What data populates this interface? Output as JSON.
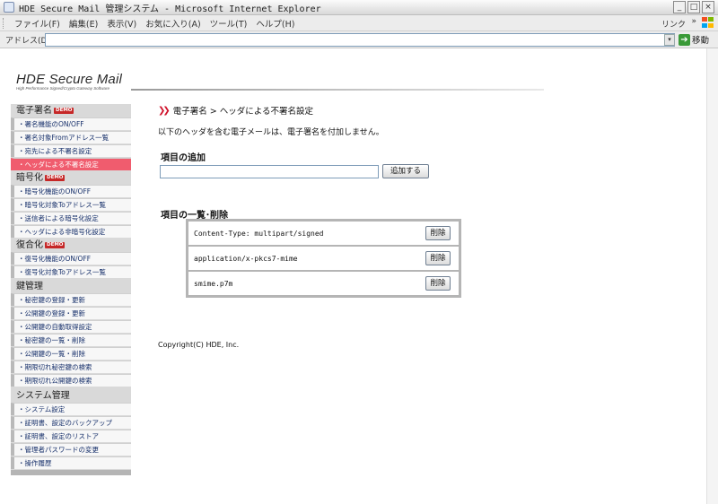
{
  "window": {
    "title": "HDE Secure Mail 管理システム - Microsoft Internet Explorer",
    "controls": [
      "_",
      "□",
      "×"
    ]
  },
  "menu": {
    "items": [
      "ファイル(F)",
      "編集(E)",
      "表示(V)",
      "お気に入り(A)",
      "ツール(T)",
      "ヘルプ(H)"
    ],
    "links_label": "リンク",
    "chevron": "»"
  },
  "address": {
    "label": "アドレス(D)",
    "value": "",
    "go_label": "移動",
    "drop_glyph": "▾",
    "go_glyph": "➔"
  },
  "logo": {
    "title": "HDE Secure Mail",
    "tagline": "High Performance Signed/Crypto Gateway Software"
  },
  "sidebar": {
    "badge": "DEMO",
    "sections": [
      {
        "label": "電子署名",
        "badge": true,
        "items": [
          "・署名機能のON/OFF",
          "・署名対象Fromアドレス一覧",
          "・宛先による不署名設定",
          "・ヘッダによる不署名設定"
        ]
      },
      {
        "label": "暗号化",
        "badge": true,
        "items": [
          "・暗号化機能のON/OFF",
          "・暗号化対象Toアドレス一覧",
          "・送信者による暗号化設定",
          "・ヘッダによる非暗号化設定"
        ]
      },
      {
        "label": "復合化",
        "badge": true,
        "items": [
          "・復号化機能のON/OFF",
          "・復号化対象Toアドレス一覧"
        ]
      },
      {
        "label": "鍵管理",
        "badge": false,
        "items": [
          "・秘密鍵の登録・更新",
          "・公開鍵の登録・更新",
          "・公開鍵の自動取得設定",
          "・秘密鍵の一覧・削除",
          "・公開鍵の一覧・削除",
          "・期限切れ秘密鍵の検索",
          "・期限切れ公開鍵の検索"
        ]
      },
      {
        "label": "システム管理",
        "badge": false,
        "items": [
          "・システム設定",
          "・証明書、設定のバックアップ",
          "・証明書、設定のリストア",
          "・管理者パスワードの変更",
          "・操作履歴"
        ]
      }
    ],
    "active_item": "・ヘッダによる不署名設定"
  },
  "content": {
    "breadcrumb_arrows": "❯❯",
    "breadcrumb": "電子署名 > ヘッダによる不署名設定",
    "description": "以下のヘッダを含む電子メールは、電子署名を付加しません。",
    "add_heading": "項目の追加",
    "add_input_value": "",
    "add_button": "追加する",
    "list_heading": "項目の一覧･削除",
    "list": [
      {
        "text": "Content-Type: multipart/signed",
        "button": "削除"
      },
      {
        "text": "application/x-pkcs7-mime",
        "button": "削除"
      },
      {
        "text": "smime.p7m",
        "button": "削除"
      }
    ],
    "copyright": "Copyright(C) HDE, Inc."
  }
}
